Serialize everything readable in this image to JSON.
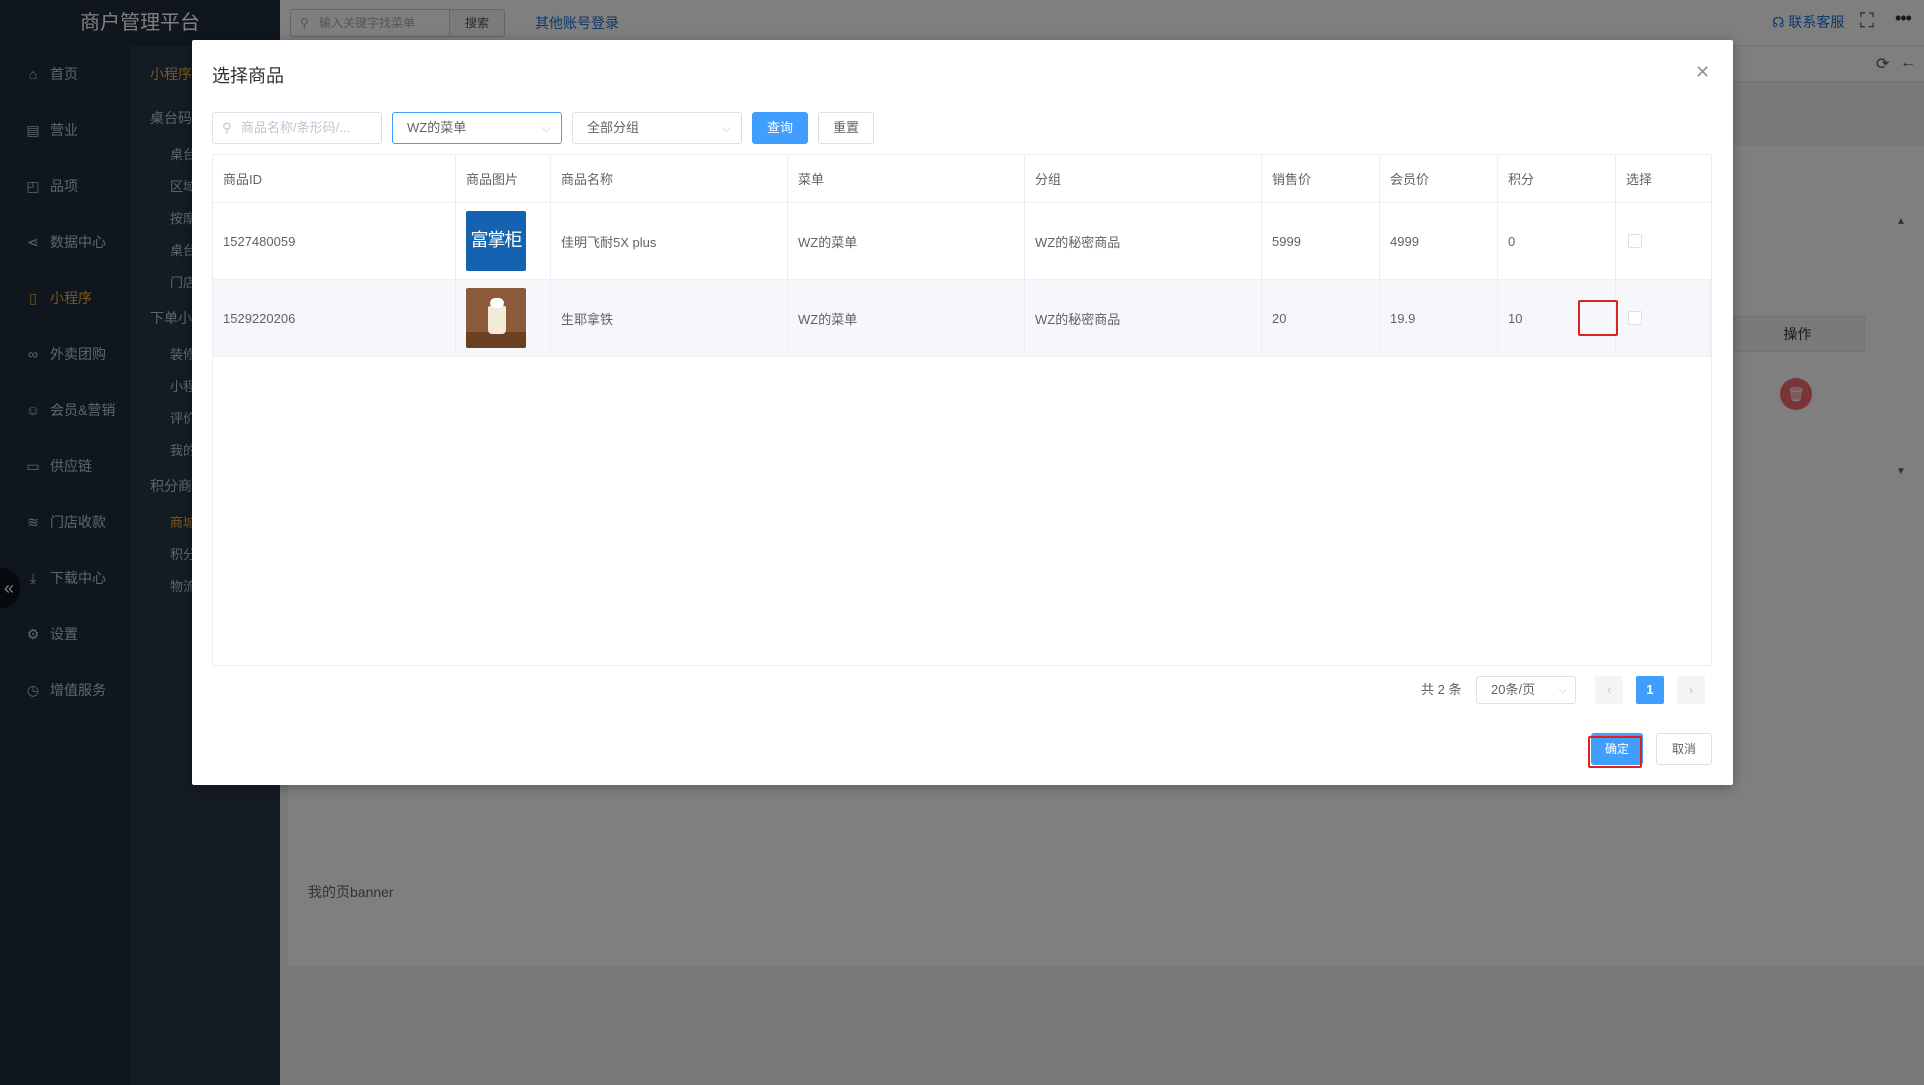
{
  "app": {
    "title": "商户管理平台",
    "search_placeholder": "输入关键字找菜单",
    "search_button": "搜索",
    "other_login": "其他账号登录",
    "contact": "联系客服"
  },
  "sidebar": {
    "items": [
      {
        "label": "首页",
        "icon": "home-icon"
      },
      {
        "label": "营业",
        "icon": "calendar-icon"
      },
      {
        "label": "品项",
        "icon": "bag-icon"
      },
      {
        "label": "数据中心",
        "icon": "share-icon"
      },
      {
        "label": "小程序",
        "icon": "phone-icon",
        "active": true
      },
      {
        "label": "外卖团购",
        "icon": "bike-icon"
      },
      {
        "label": "会员&营销",
        "icon": "user-icon"
      },
      {
        "label": "供应链",
        "icon": "truck-icon"
      },
      {
        "label": "门店收款",
        "icon": "coins-icon"
      },
      {
        "label": "下载中心",
        "icon": "download-icon"
      },
      {
        "label": "设置",
        "icon": "gear-icon"
      },
      {
        "label": "增值服务",
        "icon": "clock-icon"
      }
    ]
  },
  "subnav": {
    "title1": "小程序",
    "group1": "桌台码",
    "group1_items": [
      "桌台",
      "区域",
      "按摩",
      "桌台",
      "门店"
    ],
    "group2": "下单小",
    "group2_items": [
      "装修",
      "小程",
      "评价",
      "我的"
    ],
    "group3": "积分商",
    "group3_items": [
      "商城",
      "积分",
      "物流"
    ]
  },
  "main": {
    "ops_header": "操作",
    "banner_label": "我的页banner"
  },
  "dialog": {
    "title": "选择商品",
    "search_placeholder": "商品名称/条形码/...",
    "menu_select": "WZ的菜单",
    "group_select": "全部分组",
    "query_button": "查询",
    "reset_button": "重置",
    "columns": [
      "商品ID",
      "商品图片",
      "商品名称",
      "菜单",
      "分组",
      "销售价",
      "会员价",
      "积分",
      "选择"
    ],
    "rows": [
      {
        "id": "1527480059",
        "image_text": "富掌柜",
        "name": "佳明飞耐5X plus",
        "menu": "WZ的菜单",
        "group": "WZ的秘密商品",
        "price": "5999",
        "member_price": "4999",
        "points": "0"
      },
      {
        "id": "1529220206",
        "image_text": "",
        "name": "生耶拿铁",
        "menu": "WZ的菜单",
        "group": "WZ的秘密商品",
        "price": "20",
        "member_price": "19.9",
        "points": "10"
      }
    ],
    "pagination": {
      "total": "共 2 条",
      "page_size": "20条/页",
      "current_page": "1"
    },
    "confirm_button": "确定",
    "cancel_button": "取消"
  }
}
